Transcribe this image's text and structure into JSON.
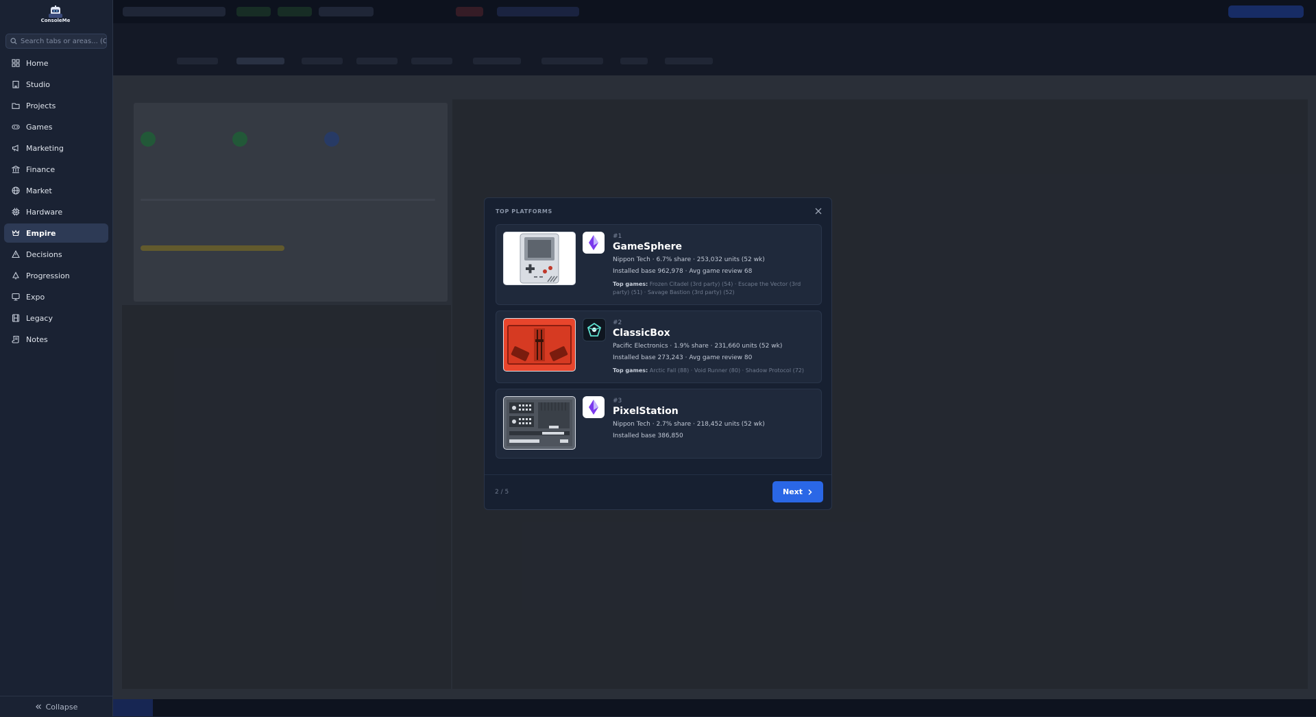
{
  "app": {
    "logo_text": "ConsoleMe"
  },
  "search": {
    "placeholder": "Search tabs or areas... (Ctrl+K)"
  },
  "sidebar": {
    "items": [
      {
        "label": "Home",
        "icon": "grid-icon",
        "active": false
      },
      {
        "label": "Studio",
        "icon": "building-icon",
        "active": false
      },
      {
        "label": "Projects",
        "icon": "folder-icon",
        "active": false
      },
      {
        "label": "Games",
        "icon": "gamepad-icon",
        "active": false
      },
      {
        "label": "Marketing",
        "icon": "megaphone-icon",
        "active": false
      },
      {
        "label": "Finance",
        "icon": "bank-icon",
        "active": false
      },
      {
        "label": "Market",
        "icon": "globe-icon",
        "active": false
      },
      {
        "label": "Hardware",
        "icon": "chip-icon",
        "active": false
      },
      {
        "label": "Empire",
        "icon": "crown-icon",
        "active": true
      },
      {
        "label": "Decisions",
        "icon": "warning-icon",
        "active": false
      },
      {
        "label": "Progression",
        "icon": "bell-icon",
        "active": false
      },
      {
        "label": "Expo",
        "icon": "monitor-icon",
        "active": false
      },
      {
        "label": "Legacy",
        "icon": "film-icon",
        "active": false
      },
      {
        "label": "Notes",
        "icon": "scroll-icon",
        "active": false
      }
    ],
    "collapse_label": "Collapse"
  },
  "modal": {
    "title": "TOP PLATFORMS",
    "platforms": [
      {
        "rank": "#1",
        "name": "GameSphere",
        "line1": "Nippon Tech · 6.7% share · 253,032 units (52 wk)",
        "line2": "Installed base 962,978 · Avg game review 68",
        "top_games_label": "Top games:",
        "top_games": "Frozen Citadel (3rd party) (54) · Escape the Vector (3rd party) (51) · Savage Bastion (3rd party) (52)"
      },
      {
        "rank": "#2",
        "name": "ClassicBox",
        "line1": "Pacific Electronics · 1.9% share · 231,660 units (52 wk)",
        "line2": "Installed base 273,243 · Avg game review 80",
        "top_games_label": "Top games:",
        "top_games": "Arctic Fall (88) · Void Runner (80) · Shadow Protocol (72)"
      },
      {
        "rank": "#3",
        "name": "PixelStation",
        "line1": "Nippon Tech · 2.7% share · 218,452 units (52 wk)",
        "line2": "Installed base 386,850"
      }
    ],
    "pager": "2 / 5",
    "next_label": "Next"
  },
  "colors": {
    "accent": "#2a67e6",
    "sidebar_bg": "#1a2233",
    "modal_bg": "#172031",
    "card_bg": "#1f293b",
    "active_item": "#2d3a55"
  }
}
